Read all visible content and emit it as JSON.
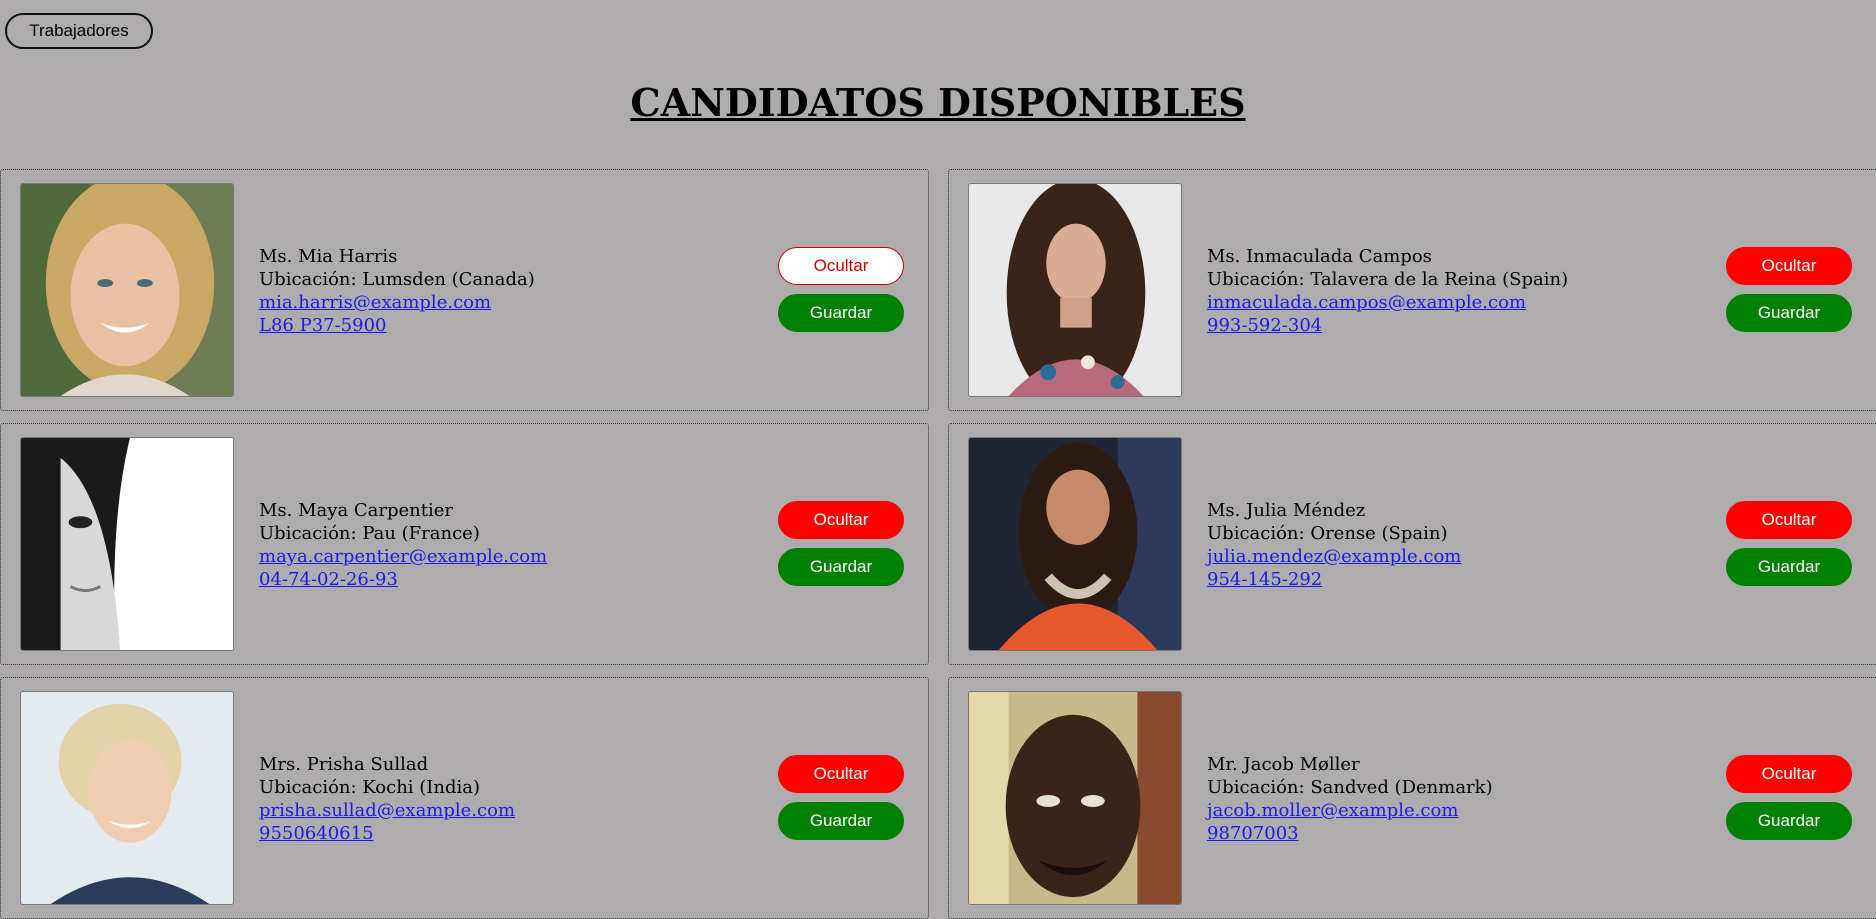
{
  "header": {
    "nav_button": "Trabajadores",
    "title": "CANDIDATOS DISPONIBLES"
  },
  "buttons": {
    "hide": "Ocultar",
    "save": "Guardar"
  },
  "colors": {
    "background": "#aeacad",
    "hide": "#ff0000",
    "save": "#008000",
    "link": "#1a1aee"
  },
  "candidates": [
    {
      "name": "Ms. Mia Harris",
      "location": "Ubicación: Lumsden (Canada)",
      "email": "mia.harris@example.com",
      "phone": "L86 P37-5900",
      "hide_state": "hover"
    },
    {
      "name": "Ms. Inmaculada Campos",
      "location": "Ubicación: Talavera de la Reina (Spain)",
      "email": "inmaculada.campos@example.com",
      "phone": "993-592-304"
    },
    {
      "name": "Ms. Maya Carpentier",
      "location": "Ubicación: Pau (France)",
      "email": "maya.carpentier@example.com",
      "phone": "04-74-02-26-93"
    },
    {
      "name": "Ms. Julia Méndez",
      "location": "Ubicación: Orense (Spain)",
      "email": "julia.mendez@example.com",
      "phone": "954-145-292"
    },
    {
      "name": "Mrs. Prisha Sullad",
      "location": "Ubicación: Kochi (India)",
      "email": "prisha.sullad@example.com",
      "phone": "9550640615"
    },
    {
      "name": "Mr. Jacob Møller",
      "location": "Ubicación: Sandved (Denmark)",
      "email": "jacob.moller@example.com",
      "phone": "98707003"
    }
  ]
}
